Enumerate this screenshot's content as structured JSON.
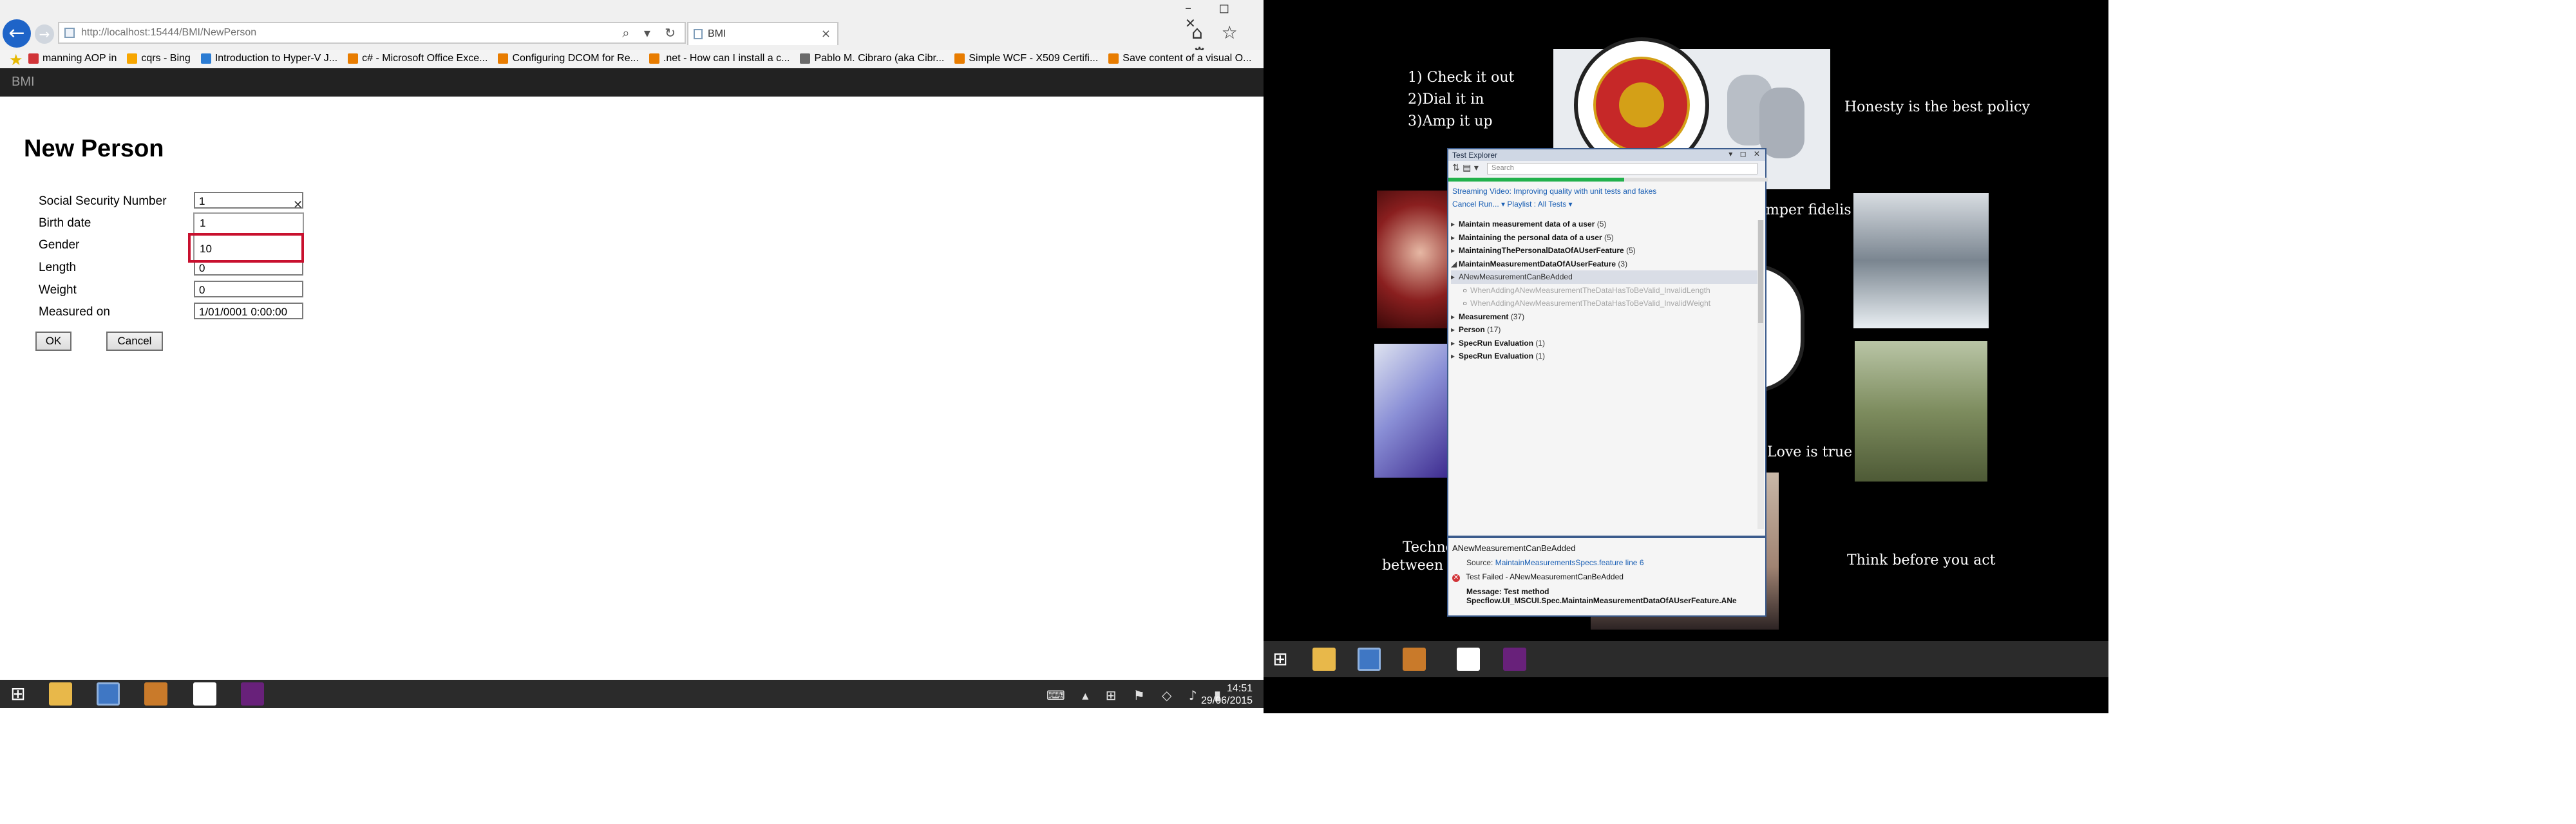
{
  "browser": {
    "address": "http://localhost:15444/BMI/NewPerson",
    "tab_label": "BMI",
    "tab_close": "×",
    "address_icons": "⌕ ▾ ↻",
    "right_icons": "⌂ ☆ ⚙",
    "window_controls": "– ◻ ✕"
  },
  "favorites": [
    {
      "label": "manning AOP in",
      "color": "#d13438"
    },
    {
      "label": "cqrs - Bing",
      "color": "#f7a600"
    },
    {
      "label": "Introduction to Hyper-V J...",
      "color": "#2b7cd3"
    },
    {
      "label": "c# - Microsoft Office Exce...",
      "color": "#e87c00"
    },
    {
      "label": "Configuring DCOM for Re...",
      "color": "#e87c00"
    },
    {
      "label": ".net - How can I install a c...",
      "color": "#e87c00"
    },
    {
      "label": "Pablo M. Cibraro (aka Cibr...",
      "color": "#6b6b6b"
    },
    {
      "label": "Simple WCF - X509 Certifi...",
      "color": "#e87c00"
    },
    {
      "label": "Save content of a visual O...",
      "color": "#e87c00"
    }
  ],
  "app": {
    "brand": "BMI"
  },
  "form": {
    "title": "New Person",
    "ssn_label": "Social Security Number",
    "ssn_value": "1",
    "birth_label": "Birth date",
    "gender_label": "Gender",
    "length_label": "Length",
    "length_value": "0",
    "weight_label": "Weight",
    "weight_value": "0",
    "measured_label": "Measured on",
    "measured_value": "1/01/0001 0:00:00",
    "autocomplete": [
      "1",
      "10"
    ],
    "ok_label": "OK",
    "cancel_label": "Cancel"
  },
  "left_taskbar": {
    "tray": "⌨ ▴ ⊞ ⚑ ◇ ♪ ▮",
    "time": "14:51",
    "date": "29/06/2015"
  },
  "wallpaper": {
    "steps": [
      "1) Check it out",
      "2)Dial it in",
      "3)Amp it up"
    ],
    "honesty": "Honesty is the best policy",
    "semper": "mper fidelis",
    "love": "Love is true",
    "think": "Think before you act",
    "techno": "Techno",
    "between": "between id"
  },
  "test_explorer": {
    "title": "Test Explorer",
    "title_buttons": "▾ ◻ ✕",
    "search_placeholder": "Search",
    "progress": 0.55,
    "stream_link": "Streaming Video: Improving quality with unit tests and fakes",
    "actions": "Cancel  Run...  ▾   Playlist : All Tests ▾",
    "tree": [
      {
        "label": "Maintain measurement data of a user",
        "count": "(5)",
        "arrow": "▸",
        "kind": "group"
      },
      {
        "label": "Maintaining the personal data of a user",
        "count": "(5)",
        "arrow": "▸",
        "kind": "group"
      },
      {
        "label": "MaintainingThePersonalDataOfAUserFeature",
        "count": "(5)",
        "arrow": "▸",
        "kind": "group"
      },
      {
        "label": "MaintainMeasurementDataOfAUserFeature",
        "count": "(3)",
        "arrow": "◢",
        "kind": "group"
      },
      {
        "label": "ANewMeasurementCanBeAdded",
        "count": "",
        "arrow": "▸",
        "kind": "selected"
      },
      {
        "label": "WhenAddingANewMeasurementTheDataHasToBeValid_InvalidLength",
        "count": "",
        "arrow": "○",
        "kind": "child"
      },
      {
        "label": "WhenAddingANewMeasurementTheDataHasToBeValid_InvalidWeight",
        "count": "",
        "arrow": "○",
        "kind": "child"
      },
      {
        "label": "Measurement",
        "count": "(37)",
        "arrow": "▸",
        "kind": "group"
      },
      {
        "label": "Person",
        "count": "(17)",
        "arrow": "▸",
        "kind": "group"
      },
      {
        "label": "SpecRun Evaluation",
        "count": "(1)",
        "arrow": "▸",
        "kind": "group"
      },
      {
        "label": "SpecRun Evaluation",
        "count": "(1)",
        "arrow": "▸",
        "kind": "group"
      }
    ],
    "detail_title": "ANewMeasurementCanBeAdded",
    "source_label": "Source:",
    "source_link": "MaintainMeasurementsSpecs.feature line 6",
    "failed_text": "Test Failed - ANewMeasurementCanBeAdded",
    "message_label": "Message: Test method",
    "message_text": "Specflow.UI_MSCUI.Spec.MaintainMeasurementDataOfAUserFeature.ANe"
  }
}
